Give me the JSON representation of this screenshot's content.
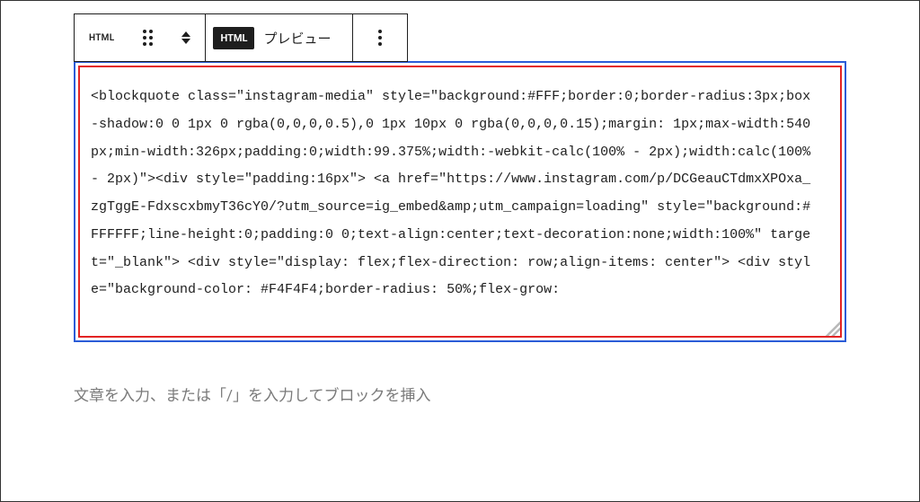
{
  "toolbar": {
    "block_type_label": "HTML",
    "html_tab_badge": "HTML",
    "preview_tab_label": "プレビュー"
  },
  "code_block": {
    "content": "<blockquote class=\"instagram-media\" style=\"background:#FFF;border:0;border-radius:3px;box-shadow:0 0 1px 0 rgba(0,0,0,0.5),0 1px 10px 0 rgba(0,0,0,0.15);margin: 1px;max-width:540px;min-width:326px;padding:0;width:99.375%;width:-webkit-calc(100% - 2px);width:calc(100% - 2px)\"><div style=\"padding:16px\"> <a href=\"https://www.instagram.com/p/DCGeauCTdmxXPOxa_zgTggE-FdxscxbmyT36cY0/?utm_source=ig_embed&amp;utm_campaign=loading\" style=\"background:#FFFFFF;line-height:0;padding:0 0;text-align:center;text-decoration:none;width:100%\" target=\"_blank\"> <div style=\"display: flex;flex-direction: row;align-items: center\"> <div style=\"background-color: #F4F4F4;border-radius: 50%;flex-grow: "
  },
  "appender": {
    "placeholder": "文章を入力、または「/」を入力してブロックを挿入"
  }
}
